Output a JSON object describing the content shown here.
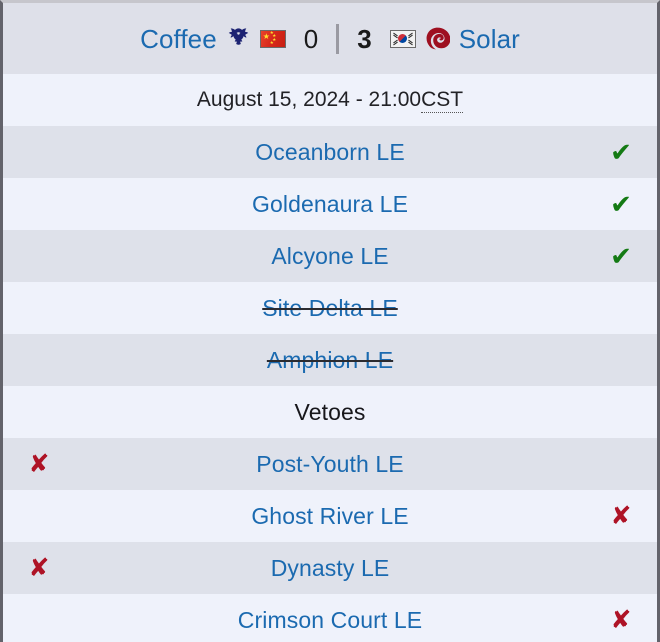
{
  "match": {
    "left_team": {
      "name": "Coffee",
      "race": "protoss",
      "race_icon": "protoss-icon",
      "country": "China",
      "flag_icon": "flag-cn-icon",
      "score": "0",
      "winner": false
    },
    "right_team": {
      "name": "Solar",
      "race": "zerg",
      "race_icon": "zerg-icon",
      "country": "South Korea",
      "flag_icon": "flag-kr-icon",
      "score": "3",
      "winner": true
    },
    "score_divider": "|",
    "datetime": "August 15, 2024 - 21:00 ",
    "timezone": "CST"
  },
  "section_header": {
    "vetoes_label": "Vetoes"
  },
  "colors": {
    "link_blue": "#1b6ab0",
    "check_green": "#147a14",
    "cross_red": "#ae1326",
    "row_shade_a": "#dee1ea",
    "row_shade_b": "#eff2fb",
    "header_bg": "#dee0e9",
    "border_gray": "#63636b"
  },
  "icons": {
    "check": "✔",
    "cross": "✘"
  },
  "maps": [
    {
      "name": "Oceanborn LE",
      "left_mark": "none",
      "right_mark": "check",
      "struck": false,
      "shade": "a"
    },
    {
      "name": "Goldenaura LE",
      "left_mark": "none",
      "right_mark": "check",
      "struck": false,
      "shade": "b"
    },
    {
      "name": "Alcyone LE",
      "left_mark": "none",
      "right_mark": "check",
      "struck": false,
      "shade": "a"
    },
    {
      "name": "Site Delta LE",
      "left_mark": "none",
      "right_mark": "none",
      "struck": true,
      "shade": "b"
    },
    {
      "name": "Amphion LE",
      "left_mark": "none",
      "right_mark": "none",
      "struck": true,
      "shade": "a"
    }
  ],
  "vetoes": [
    {
      "name": "Post-Youth LE",
      "left_mark": "cross",
      "right_mark": "none",
      "struck": false,
      "shade": "a"
    },
    {
      "name": "Ghost River LE",
      "left_mark": "none",
      "right_mark": "cross",
      "struck": false,
      "shade": "b"
    },
    {
      "name": "Dynasty LE",
      "left_mark": "cross",
      "right_mark": "none",
      "struck": false,
      "shade": "a"
    },
    {
      "name": "Crimson Court LE",
      "left_mark": "none",
      "right_mark": "cross",
      "struck": false,
      "shade": "b"
    }
  ]
}
